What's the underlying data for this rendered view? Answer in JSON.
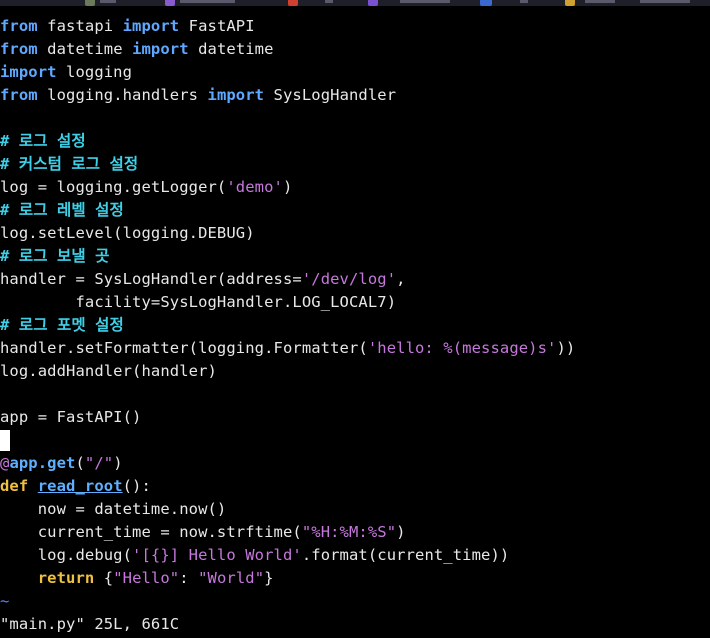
{
  "topbar": {
    "icons": [
      "app-icon-1",
      "app-icon-2",
      "app-icon-3",
      "app-icon-4",
      "app-icon-5",
      "app-icon-6"
    ]
  },
  "code": {
    "l1": {
      "k1": "from",
      "t1": " fastapi ",
      "k2": "import",
      "t2": " FastAPI"
    },
    "l2": {
      "k1": "from",
      "t1": " datetime ",
      "k2": "import",
      "t2": " datetime"
    },
    "l3": {
      "k1": "import",
      "t1": " logging"
    },
    "l4": {
      "k1": "from",
      "t1": " logging.handlers ",
      "k2": "import",
      "t2": " SysLogHandler"
    },
    "l6": {
      "c": "# 로그 설정"
    },
    "l7": {
      "c": "# 커스텀 로그 설정"
    },
    "l8": {
      "t1": "log = logging.getLogger(",
      "s1": "'demo'",
      "t2": ")"
    },
    "l9": {
      "c": "# 로그 레벨 설정"
    },
    "l10": {
      "t1": "log.setLevel(logging.DEBUG)"
    },
    "l11": {
      "c": "# 로그 보낼 곳"
    },
    "l12": {
      "t1": "handler = SysLogHandler(address=",
      "s1": "'/dev/log'",
      "t2": ","
    },
    "l13": {
      "t1": "        facility=SysLogHandler.LOG_LOCAL7)"
    },
    "l14": {
      "c": "# 로그 포멧 설정"
    },
    "l15": {
      "t1": "handler.setFormatter(logging.Formatter(",
      "s1": "'hello: %(message)s'",
      "t2": "))"
    },
    "l16": {
      "t1": "log.addHandler(handler)"
    },
    "l18": {
      "t1": "app = FastAPI()"
    },
    "l20": {
      "d": "@",
      "f": "app.get",
      "t1": "(",
      "s1": "\"/\"",
      "t2": ")"
    },
    "l21": {
      "k": "def",
      "sp": " ",
      "fn": "read_root",
      "t1": "():"
    },
    "l22": {
      "t1": "    now = datetime.now()"
    },
    "l23": {
      "t1": "    current_time = now.strftime(",
      "s1": "\"%H:%M:%S\"",
      "t2": ")"
    },
    "l24": {
      "t1": "    log.debug(",
      "s1": "'[{}] Hello World'",
      "t2": ".format(current_time))"
    },
    "l25": {
      "ind": "    ",
      "k": "return",
      "t1": " {",
      "s1": "\"Hello\"",
      "t2": ": ",
      "s2": "\"World\"",
      "t3": "}"
    }
  },
  "tilde": "~",
  "status": {
    "filename": "\"main.py\"",
    "info": " 25L, 661C"
  }
}
